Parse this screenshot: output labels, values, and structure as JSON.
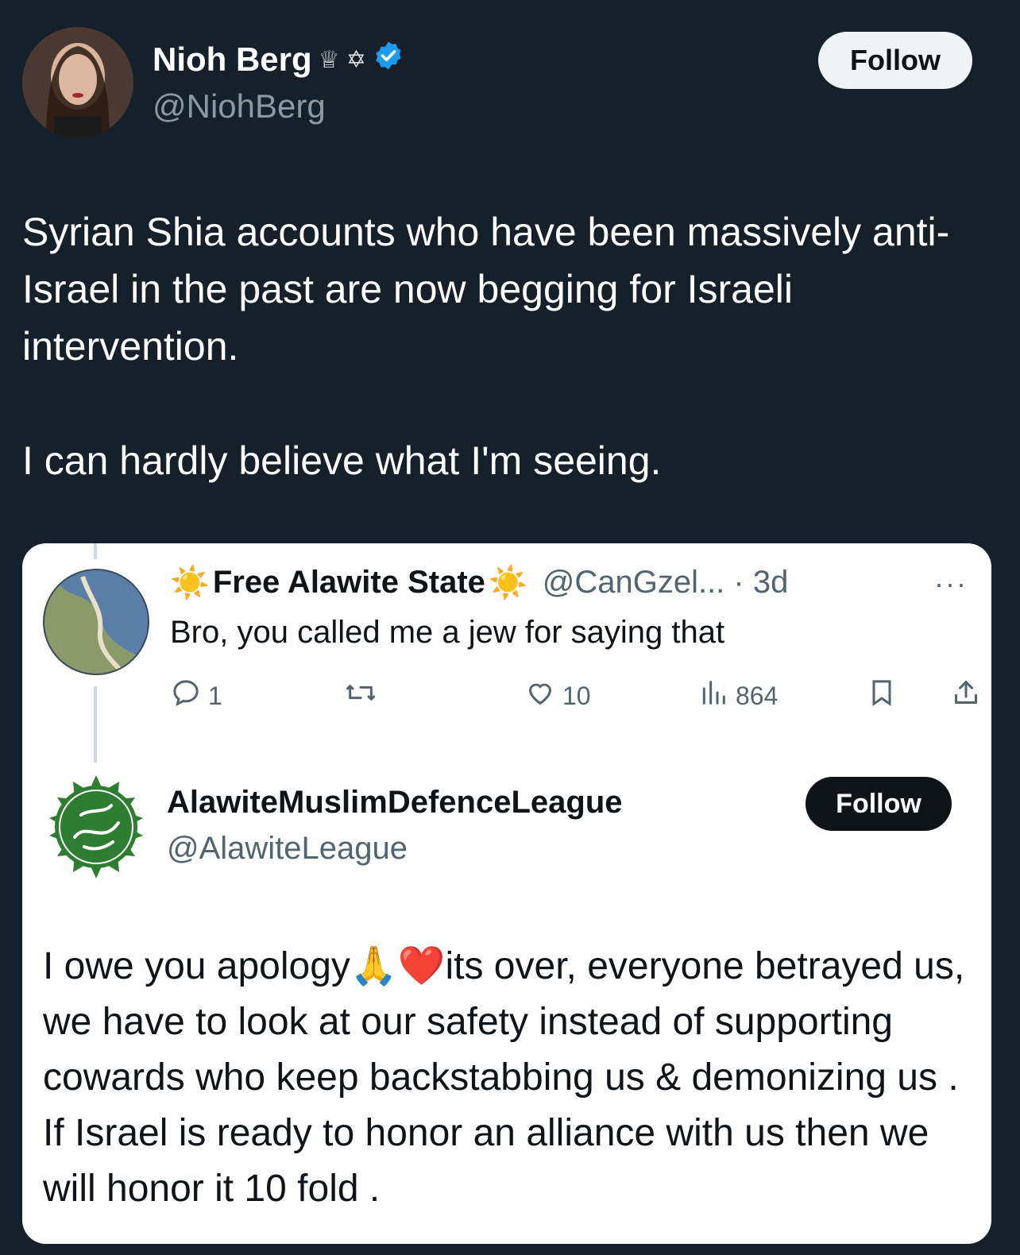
{
  "tweet": {
    "author": {
      "name": "Nioh Berg",
      "glyphs": "♕ ✡",
      "handle": "@NiohBerg",
      "verified": true
    },
    "follow_label": "Follow",
    "text_paragraph_1": "Syrian Shia accounts who have been massively anti-Israel in the past are now begging for Israeli intervention.",
    "text_paragraph_2": "I can hardly believe what I'm seeing."
  },
  "screenshot_card": {
    "reply": {
      "name_prefix": "☀️",
      "name": "Free Alawite State",
      "name_suffix": "☀️",
      "handle_time": "@CanGzel... · 3d",
      "more": "···",
      "text": "Bro, you called me a jew for saying that",
      "actions": {
        "replies": "1",
        "retweets": "",
        "likes": "10",
        "views": "864"
      }
    },
    "quoted": {
      "name": "AlawiteMuslimDefenceLeague",
      "handle": "@AlawiteLeague",
      "follow_label": "Follow",
      "text": "I owe you apology🙏❤️its over, everyone betrayed us, we have to look at our safety instead of supporting cowards who keep backstabbing us & demonizing us . If Israel is ready to honor an alliance with us then we will honor it 10 fold ."
    }
  },
  "colors": {
    "background": "#15202b",
    "verified": "#1d9bf0",
    "card_bg": "#ffffff",
    "seal_green": "#2e7d32"
  }
}
